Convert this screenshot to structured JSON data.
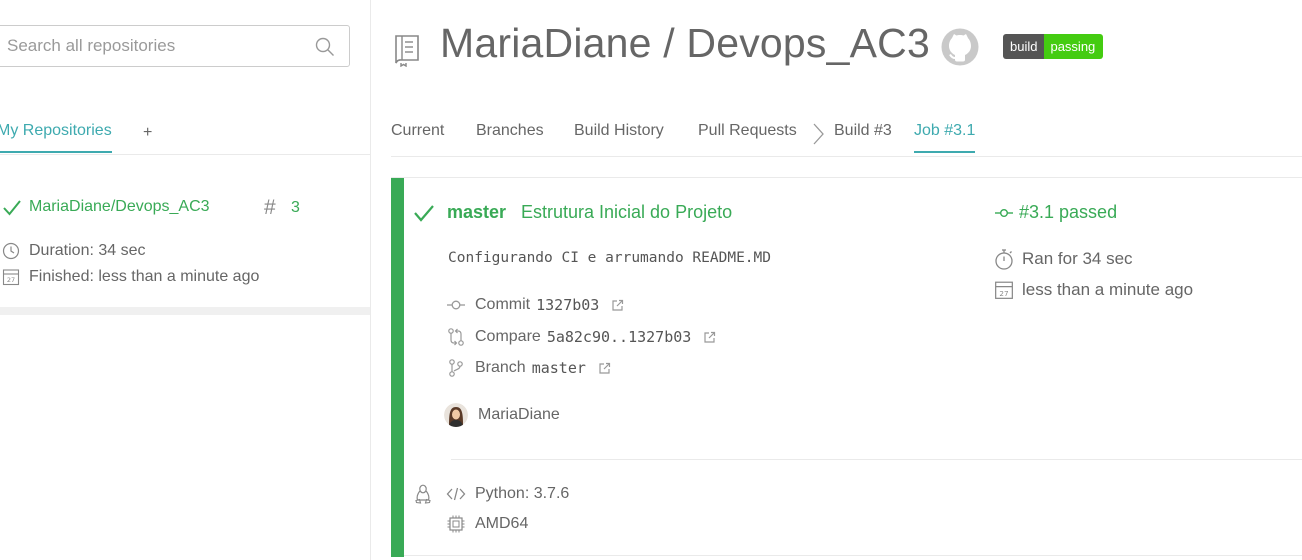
{
  "search": {
    "placeholder": "Search all repositories"
  },
  "sidebar": {
    "tab_label": "My Repositories",
    "add_label": "+",
    "repo": {
      "name": "MariaDiane/Devops_AC3",
      "build_number": "3",
      "duration": "Duration: 34 sec",
      "finished": "Finished: less than a minute ago"
    }
  },
  "header": {
    "title": "MariaDiane / Devops_AC3",
    "badge_left": "build",
    "badge_right": "passing"
  },
  "tabs": [
    {
      "label": "Current"
    },
    {
      "label": "Branches"
    },
    {
      "label": "Build History"
    },
    {
      "label": "Pull Requests"
    },
    {
      "label": "Build #3"
    },
    {
      "label": "Job #3.1"
    }
  ],
  "job": {
    "branch": "master",
    "commit_title": "Estrutura Inicial do Projeto",
    "message": "Configurando CI e arrumando README.MD",
    "commit_label": "Commit",
    "commit_sha": "1327b03",
    "compare_label": "Compare",
    "compare_range": "5a82c90..1327b03",
    "branch_label": "Branch",
    "branch_value": "master",
    "author": "MariaDiane",
    "language": "Python: 3.7.6",
    "arch": "AMD64",
    "job_number": "#3.1 passed",
    "ran_for": "Ran for 34 sec",
    "finished": "less than a minute ago"
  },
  "colors": {
    "passed_green": "#39aa56",
    "accent_teal": "#3eaaaf",
    "text_gray": "#666666",
    "badge_green": "#44cc11",
    "badge_gray": "#555555"
  },
  "icons": [
    "search-icon",
    "check-icon",
    "hash-icon",
    "clock-icon",
    "calendar-icon",
    "repo-icon",
    "github-icon",
    "chevron-right-icon",
    "commit-icon",
    "compare-icon",
    "branch-icon",
    "external-link-icon",
    "linux-icon",
    "code-icon",
    "cpu-icon",
    "stopwatch-icon"
  ]
}
